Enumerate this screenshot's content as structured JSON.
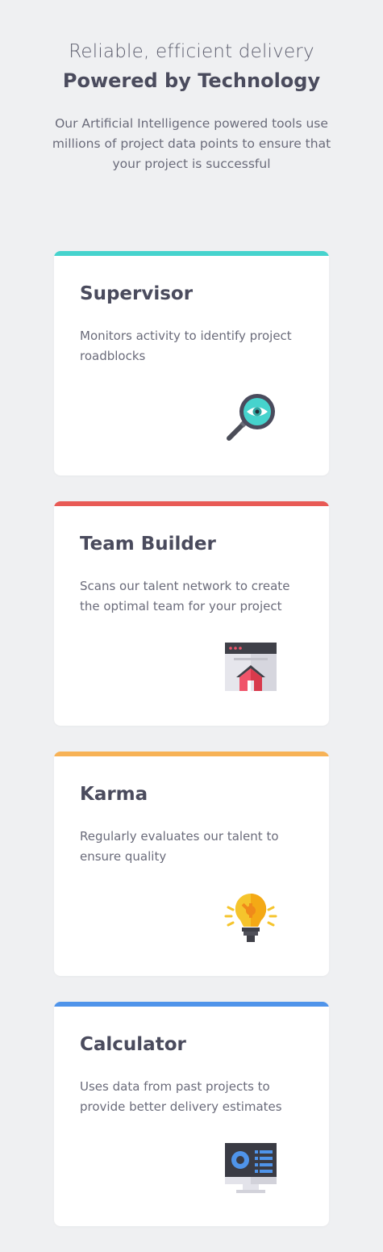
{
  "hero": {
    "subtitle": "Reliable, efficient delivery",
    "title": "Powered by Technology",
    "description": "Our Artificial Intelligence powered tools use millions of project data points to ensure that your project is successful"
  },
  "cards": [
    {
      "title": "Supervisor",
      "description": "Monitors activity to identify project roadblocks",
      "accent": "#46d3cd",
      "icon": "magnifier-eye-icon"
    },
    {
      "title": "Team Builder",
      "description": "Scans our talent network to create the optimal team for your project",
      "accent": "#e85a55",
      "icon": "browser-house-icon"
    },
    {
      "title": "Karma",
      "description": "Regularly evaluates our talent to ensure quality",
      "accent": "#f7b256",
      "icon": "lightbulb-icon"
    },
    {
      "title": "Calculator",
      "description": "Uses data from past projects to provide better delivery estimates",
      "accent": "#4f94ea",
      "icon": "monitor-chart-icon"
    }
  ]
}
